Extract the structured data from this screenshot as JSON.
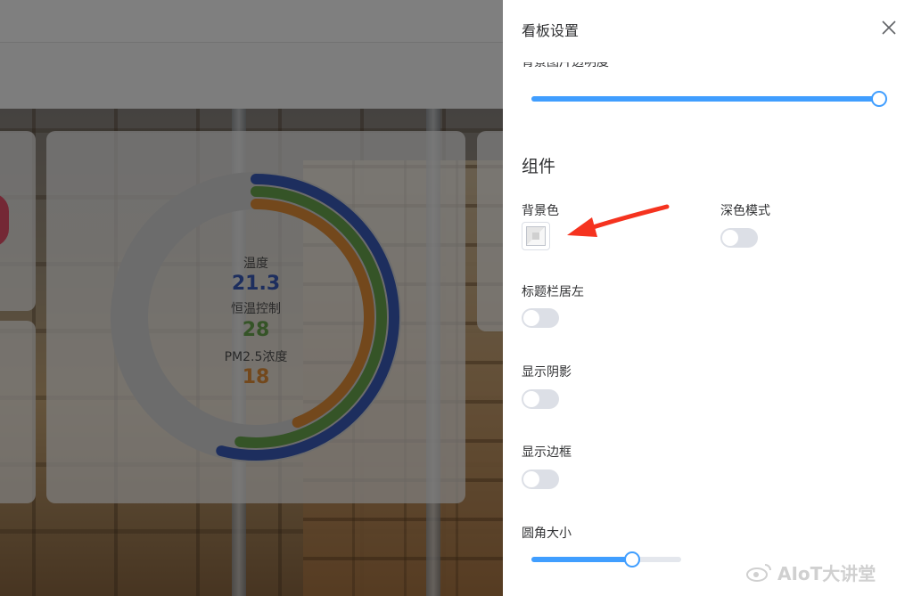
{
  "dashboard": {
    "ring_chart": {
      "metrics": [
        {
          "label": "温度",
          "value": "21.3",
          "color": "#3b5dbd"
        },
        {
          "label": "恒温控制",
          "value": "28",
          "color": "#6aa84f"
        },
        {
          "label": "PM2.5浓度",
          "value": "18",
          "color": "#e69138"
        }
      ]
    }
  },
  "drawer": {
    "title": "看板设置",
    "partial_label": "背景图片透明度",
    "bg_opacity_slider": {
      "value_fraction": 1.0,
      "color": "#409eff"
    },
    "section_title": "组件",
    "fields": {
      "background_color": {
        "label": "背景色"
      },
      "dark_mode": {
        "label": "深色模式",
        "on": false
      },
      "title_bar_left": {
        "label": "标题栏居左",
        "on": false
      },
      "show_shadow": {
        "label": "显示阴影",
        "on": false
      },
      "show_border": {
        "label": "显示边框",
        "on": false
      },
      "corner_radius": {
        "label": "圆角大小",
        "value_fraction": 0.67
      }
    }
  },
  "watermark": {
    "text": "AIoT大讲堂"
  },
  "annotation": {
    "arrow_color": "#f5331f"
  }
}
